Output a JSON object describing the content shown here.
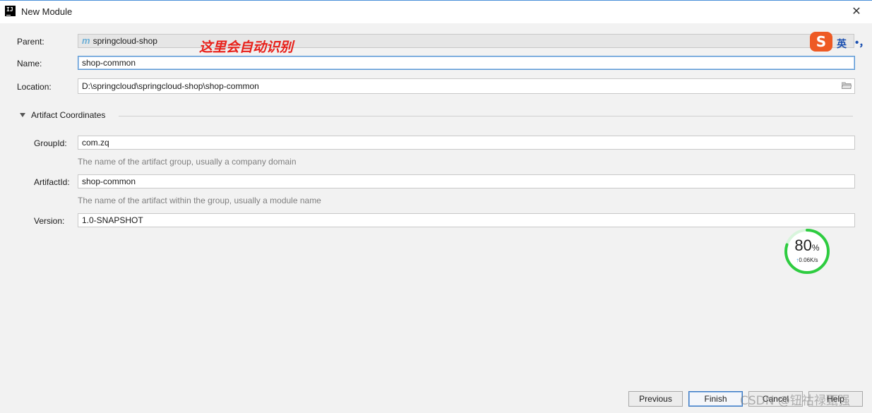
{
  "window": {
    "title": "New Module",
    "close_glyph": "✕"
  },
  "annotation": "这里会自动识别",
  "form": {
    "parent": {
      "label": "Parent:",
      "value": "springcloud-shop",
      "icon": "m"
    },
    "name": {
      "label": "Name:",
      "value": "shop-common"
    },
    "location": {
      "label": "Location:",
      "value": "D:\\springcloud\\springcloud-shop\\shop-common"
    }
  },
  "artifact": {
    "section_title": "Artifact Coordinates",
    "group_id": {
      "label": "GroupId:",
      "value": "com.zq",
      "hint": "The name of the artifact group, usually a company domain"
    },
    "artifact_id": {
      "label": "ArtifactId:",
      "value": "shop-common",
      "hint": "The name of the artifact within the group, usually a module name"
    },
    "version": {
      "label": "Version:",
      "value": "1.0-SNAPSHOT"
    }
  },
  "ime": {
    "logo": "S",
    "lang": "英",
    "punct": "•，"
  },
  "net_widget": {
    "percent": "80",
    "percent_unit": "%",
    "speed": "0.06K/s",
    "progress": 0.8
  },
  "buttons": {
    "previous_label": "Previous",
    "finish_label": "Finish",
    "cancel_label": "Cancel",
    "help_label": "Help"
  },
  "watermark": "CSDN @钮祜禄甄强",
  "colors": {
    "annotation": "#e8201a",
    "focus_border": "#5898d4",
    "widget_ring": "#2ecc40",
    "ime_logo": "#ee5a24"
  }
}
